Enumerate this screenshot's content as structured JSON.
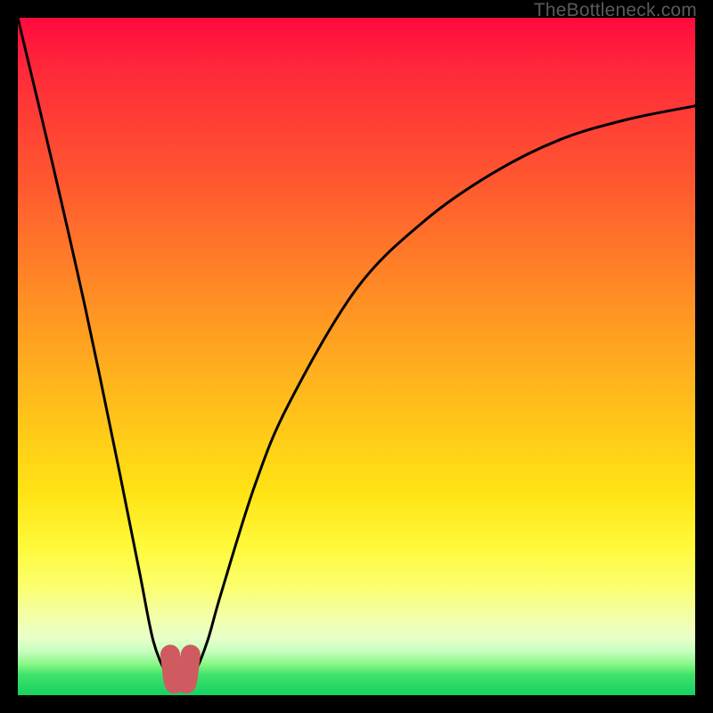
{
  "watermark": "TheBottleneck.com",
  "chart_data": {
    "type": "line",
    "title": "",
    "xlabel": "",
    "ylabel": "",
    "xlim": [
      0,
      100
    ],
    "ylim": [
      0,
      100
    ],
    "series": [
      {
        "name": "bottleneck-curve",
        "x": [
          0,
          5,
          10,
          15,
          18,
          20,
          22,
          23,
          24,
          25,
          26,
          28,
          30,
          35,
          40,
          50,
          60,
          70,
          80,
          90,
          100
        ],
        "values": [
          100,
          79,
          57,
          33,
          18,
          8,
          3,
          2,
          2,
          2,
          3,
          8,
          15,
          31,
          43,
          60,
          70,
          77,
          82,
          85,
          87
        ]
      },
      {
        "name": "bottom-marker",
        "x": [
          22.5,
          23,
          23.5,
          24,
          24.5,
          25,
          25.5
        ],
        "values": [
          6,
          2,
          2,
          2,
          2,
          2,
          6
        ]
      }
    ],
    "gradient_stops": [
      {
        "pos": 0,
        "color": "#ff0a3f"
      },
      {
        "pos": 0.25,
        "color": "#ff5a2f"
      },
      {
        "pos": 0.55,
        "color": "#ffb81c"
      },
      {
        "pos": 0.78,
        "color": "#fff93a"
      },
      {
        "pos": 0.92,
        "color": "#e8ffc8"
      },
      {
        "pos": 1.0,
        "color": "#16d161"
      }
    ]
  }
}
